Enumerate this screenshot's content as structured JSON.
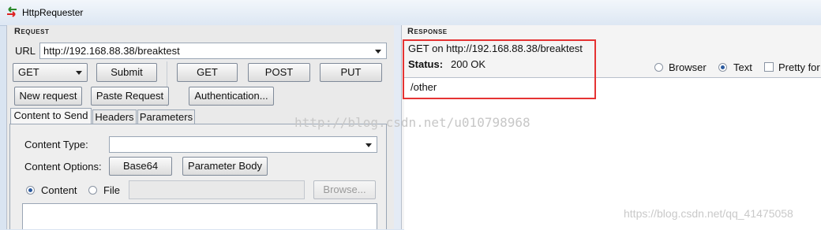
{
  "window": {
    "title": "HttpRequester"
  },
  "request": {
    "section_title": "Request",
    "url_label": "URL",
    "url_value": "http://192.168.88.38/breaktest",
    "method_selected": "GET",
    "submit": "Submit",
    "get": "GET",
    "post": "POST",
    "put": "PUT",
    "new_request": "New request",
    "paste_request": "Paste Request",
    "authentication": "Authentication...",
    "tabs": [
      "Content to Send",
      "Headers",
      "Parameters"
    ],
    "content_type_label": "Content Type:",
    "content_type_value": "",
    "content_options_label": "Content Options:",
    "base64": "Base64",
    "parameter_body": "Parameter Body",
    "content_radio": "Content",
    "file_radio": "File",
    "browse": "Browse..."
  },
  "response": {
    "section_title": "Response",
    "summary": "GET on http://192.168.88.38/breaktest",
    "status_label": "Status:",
    "status_value": "200 OK",
    "view_browser": "Browser",
    "view_text": "Text",
    "pretty_format": "Pretty for",
    "body_text": "/other"
  },
  "watermarks": {
    "center": "http://blog.csdn.net/u010798968",
    "bottom_right": "https://blog.csdn.net/qq_41475058"
  },
  "colors": {
    "highlight": "#e53333"
  }
}
